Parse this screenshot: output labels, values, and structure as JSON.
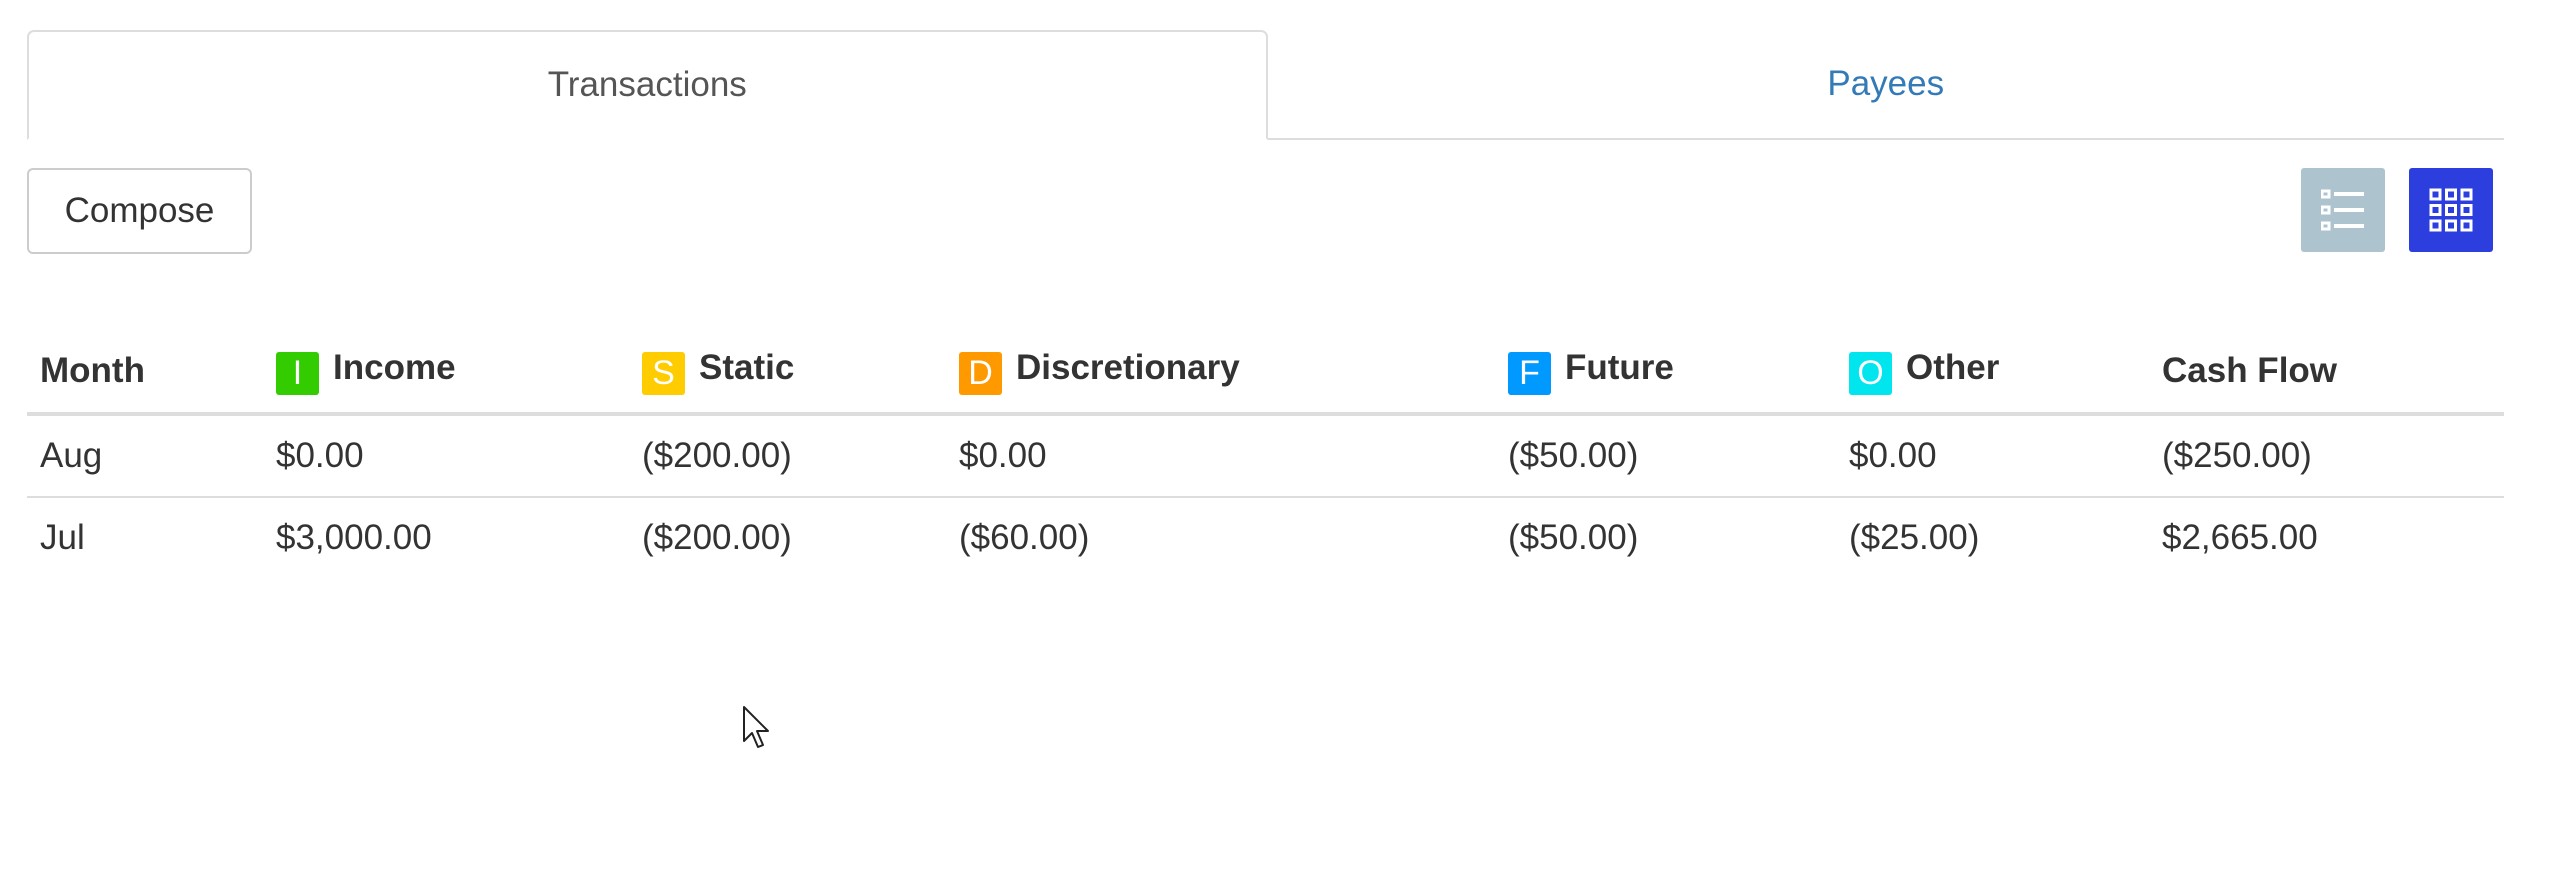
{
  "tabs": [
    {
      "label": "Transactions",
      "active": true
    },
    {
      "label": "Payees",
      "active": false
    }
  ],
  "toolbar": {
    "compose_label": "Compose",
    "list_view_icon": "list-icon",
    "grid_view_icon": "grid-icon",
    "list_view_color": "#adc4cf",
    "grid_view_color": "#2c3ede"
  },
  "table": {
    "headers": [
      {
        "label": "Month"
      },
      {
        "label": "Income",
        "badge": "I",
        "badge_color": "#33cc00"
      },
      {
        "label": "Static",
        "badge": "S",
        "badge_color": "#ffcc00"
      },
      {
        "label": "Discretionary",
        "badge": "D",
        "badge_color": "#ff9900"
      },
      {
        "label": "Future",
        "badge": "F",
        "badge_color": "#0099ff"
      },
      {
        "label": "Other",
        "badge": "O",
        "badge_color": "#00e5ee"
      },
      {
        "label": "Cash Flow"
      }
    ],
    "rows": [
      [
        "Aug",
        "$0.00",
        "($200.00)",
        "$0.00",
        "($50.00)",
        "$0.00",
        "($250.00)"
      ],
      [
        "Jul",
        "$3,000.00",
        "($200.00)",
        "($60.00)",
        "($50.00)",
        "($25.00)",
        "$2,665.00"
      ]
    ]
  },
  "colors": {
    "link": "#337ab7",
    "border": "#dddddd",
    "text": "#333333"
  }
}
